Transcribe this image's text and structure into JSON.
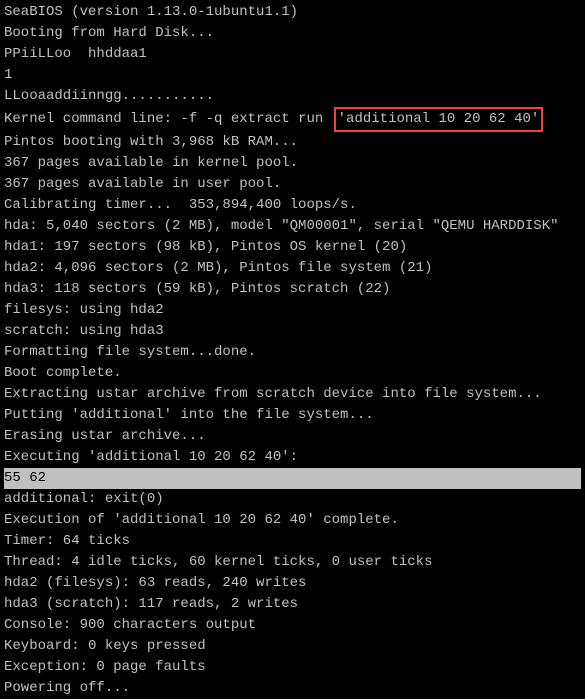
{
  "lines": [
    "SeaBIOS (version 1.13.0-1ubuntu1.1)",
    "Booting from Hard Disk...",
    "PPiiLLoo  hhddaa1",
    "1",
    "LLooaaddiinngg...........",
    "Pintos booting with 3,968 kB RAM...",
    "367 pages available in kernel pool.",
    "367 pages available in user pool.",
    "Calibrating timer...  353,894,400 loops/s.",
    "hda: 5,040 sectors (2 MB), model \"QM00001\", serial \"QEMU HARDDISK\"",
    "hda1: 197 sectors (98 kB), Pintos OS kernel (20)",
    "hda2: 4,096 sectors (2 MB), Pintos file system (21)",
    "hda3: 118 sectors (59 kB), Pintos scratch (22)",
    "filesys: using hda2",
    "scratch: using hda3",
    "Formatting file system...done.",
    "Boot complete.",
    "Extracting ustar archive from scratch device into file system...",
    "Putting 'additional' into the file system...",
    "Erasing ustar archive...",
    "Executing 'additional 10 20 62 40':",
    "additional: exit(0)",
    "Execution of 'additional 10 20 62 40' complete.",
    "Timer: 64 ticks",
    "Thread: 4 idle ticks, 60 kernel ticks, 0 user ticks",
    "hda2 (filesys): 63 reads, 240 writes",
    "hda3 (scratch): 117 reads, 2 writes",
    "Console: 900 characters output",
    "Keyboard: 0 keys pressed",
    "Exception: 0 page faults",
    "Powering off..."
  ],
  "kernel_line_prefix": "Kernel command line: -f -q extract run ",
  "kernel_line_highlight": "'additional 10 20 62 40'",
  "highlighted_output": "55 62"
}
